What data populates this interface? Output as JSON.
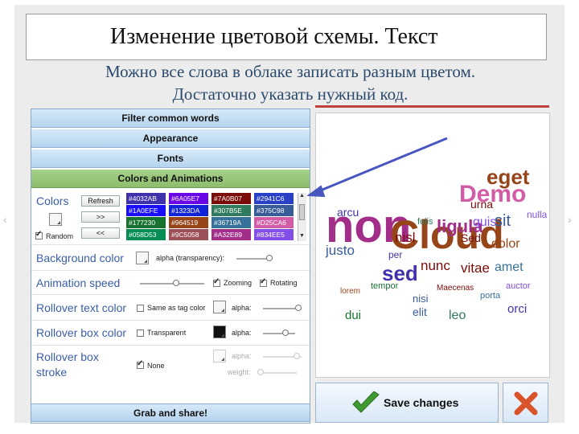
{
  "slide": {
    "title": "Изменение цветовой схемы. Текст",
    "subtitle_line1": "Можно все слова в облаке записать разным цветом.",
    "subtitle_line2": "Достаточно указать нужный код."
  },
  "accordion": {
    "filter": "Filter common words",
    "appearance": "Appearance",
    "fonts": "Fonts",
    "colors_anim": "Colors and Animations",
    "grab": "Grab and share!"
  },
  "colors": {
    "label": "Colors",
    "refresh": "Refresh",
    "next": ">>",
    "prev": "<<",
    "random_label": "Random",
    "codes": [
      {
        "text": "#4032AB",
        "color": "#4032AB"
      },
      {
        "text": "#6A05E7",
        "color": "#6A05E7"
      },
      {
        "text": "#7A0B07",
        "color": "#7A0B07"
      },
      {
        "text": "#2941C6",
        "color": "#2941C6"
      },
      {
        "text": "#1A0EFE",
        "color": "#1A0EFE"
      },
      {
        "text": "#1323DA",
        "color": "#1323DA"
      },
      {
        "text": "#307B5E",
        "color": "#307B5E"
      },
      {
        "text": "#375C98",
        "color": "#375C98"
      },
      {
        "text": "#177230",
        "color": "#177230"
      },
      {
        "text": "#964519",
        "color": "#964519"
      },
      {
        "text": "#36719A",
        "color": "#36719A"
      },
      {
        "text": "#D25CA6",
        "color": "#D25CA6"
      },
      {
        "text": "#058D53",
        "color": "#058D53"
      },
      {
        "text": "#9C5058",
        "color": "#9C5058"
      },
      {
        "text": "#A32E89",
        "color": "#A32E89"
      },
      {
        "text": "#834EE5",
        "color": "#834EE5"
      }
    ]
  },
  "background": {
    "label": "Background color",
    "alpha": "alpha (transparency):"
  },
  "animation": {
    "label": "Animation speed",
    "zooming": "Zooming",
    "rotating": "Rotating"
  },
  "rollover_text": {
    "label": "Rollover text color",
    "same": "Same as tag color",
    "alpha": "alpha:"
  },
  "rollover_box": {
    "label": "Rollover box color",
    "transparent": "Transparent",
    "alpha": "alpha:"
  },
  "rollover_stroke": {
    "label1": "Rollover box",
    "label2": "stroke",
    "none": "None",
    "alpha": "alpha:",
    "weight": "weight:"
  },
  "cloud_words": [
    {
      "t": "non",
      "c": "#A32E89"
    },
    {
      "t": "Cloud",
      "c": "#964519"
    },
    {
      "t": "Demo",
      "c": "#D25CA6"
    },
    {
      "t": "nisl",
      "c": "#7A0B07"
    },
    {
      "t": "ligula",
      "c": "#A32E89"
    },
    {
      "t": "sed",
      "c": "#4032AB"
    },
    {
      "t": "sit",
      "c": "#375C98"
    },
    {
      "t": "eget",
      "c": "#964519"
    },
    {
      "t": "nunc",
      "c": "#7A0B07"
    },
    {
      "t": "vitae",
      "c": "#7A0B07"
    },
    {
      "t": "amet",
      "c": "#36719A"
    },
    {
      "t": "quis",
      "c": "#834EE5"
    },
    {
      "t": "dolor",
      "c": "#964519"
    },
    {
      "t": "urna",
      "c": "#7A0B07"
    },
    {
      "t": "arcu",
      "c": "#4032AB"
    },
    {
      "t": "justo",
      "c": "#375C98"
    },
    {
      "t": "dui",
      "c": "#177230"
    },
    {
      "t": "elit",
      "c": "#375C98"
    },
    {
      "t": "leo",
      "c": "#307B5E"
    },
    {
      "t": "orci",
      "c": "#4032AB"
    },
    {
      "t": "nulla",
      "c": "#834EE5"
    },
    {
      "t": "Sed",
      "c": "#7A0B07"
    },
    {
      "t": "per",
      "c": "#4032AB"
    },
    {
      "t": "felis",
      "c": "#307B5E"
    },
    {
      "t": "nisi",
      "c": "#375C98"
    },
    {
      "t": "porta",
      "c": "#36719A"
    },
    {
      "t": "auctor",
      "c": "#834EE5"
    },
    {
      "t": "Maecenas",
      "c": "#7A0B07"
    },
    {
      "t": "tempor",
      "c": "#177230"
    },
    {
      "t": "lorem",
      "c": "#964519"
    }
  ],
  "buttons": {
    "save": "Save changes"
  },
  "theme": {
    "accent_blue": "#3a5ea8",
    "arrow": "#4a56c0"
  }
}
